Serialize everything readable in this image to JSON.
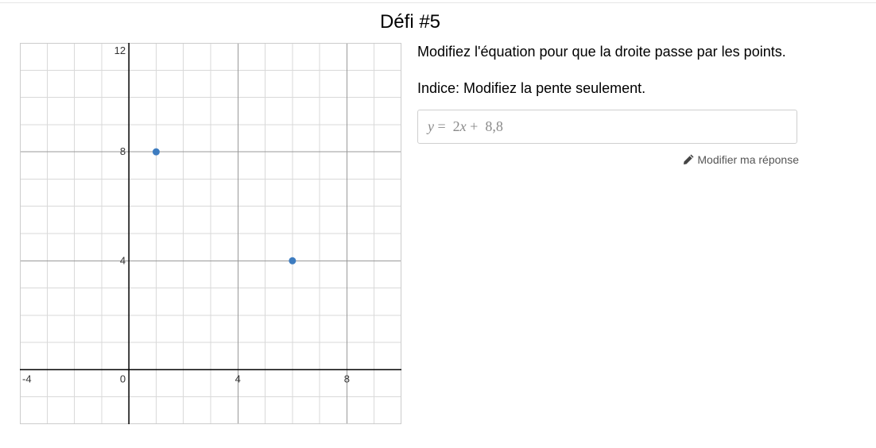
{
  "page": {
    "title": "Défi #5"
  },
  "instructions": {
    "text": "Modifiez l'équation pour que la droite passe par les points.",
    "hint": "Indice: Modifiez la pente seulement."
  },
  "equation": {
    "lhs": "y",
    "equals": "=",
    "slope": "2",
    "var": "x",
    "plus": "+",
    "intercept": "8,8"
  },
  "edit_action": {
    "label": "Modifier ma réponse",
    "icon": "pencil-icon"
  },
  "chart_data": {
    "type": "scatter",
    "xlim": [
      -4,
      10
    ],
    "ylim": [
      -2,
      12
    ],
    "x_ticks": [
      {
        "value": -4,
        "label": "-4"
      },
      {
        "value": 0,
        "label": "0"
      },
      {
        "value": 4,
        "label": "4"
      },
      {
        "value": 8,
        "label": "8"
      }
    ],
    "y_ticks": [
      {
        "value": 4,
        "label": "4"
      },
      {
        "value": 8,
        "label": "8"
      },
      {
        "value": 12,
        "label": "12"
      }
    ],
    "minor_grid_step": 1,
    "major_grid_step": 4,
    "grid": true,
    "points": [
      {
        "x": 1,
        "y": 8
      },
      {
        "x": 6,
        "y": 4
      }
    ],
    "colors": {
      "point": "#3d7cc0",
      "minor_grid": "#d9d9d9",
      "major_grid": "#999999",
      "axis": "#000000"
    }
  }
}
